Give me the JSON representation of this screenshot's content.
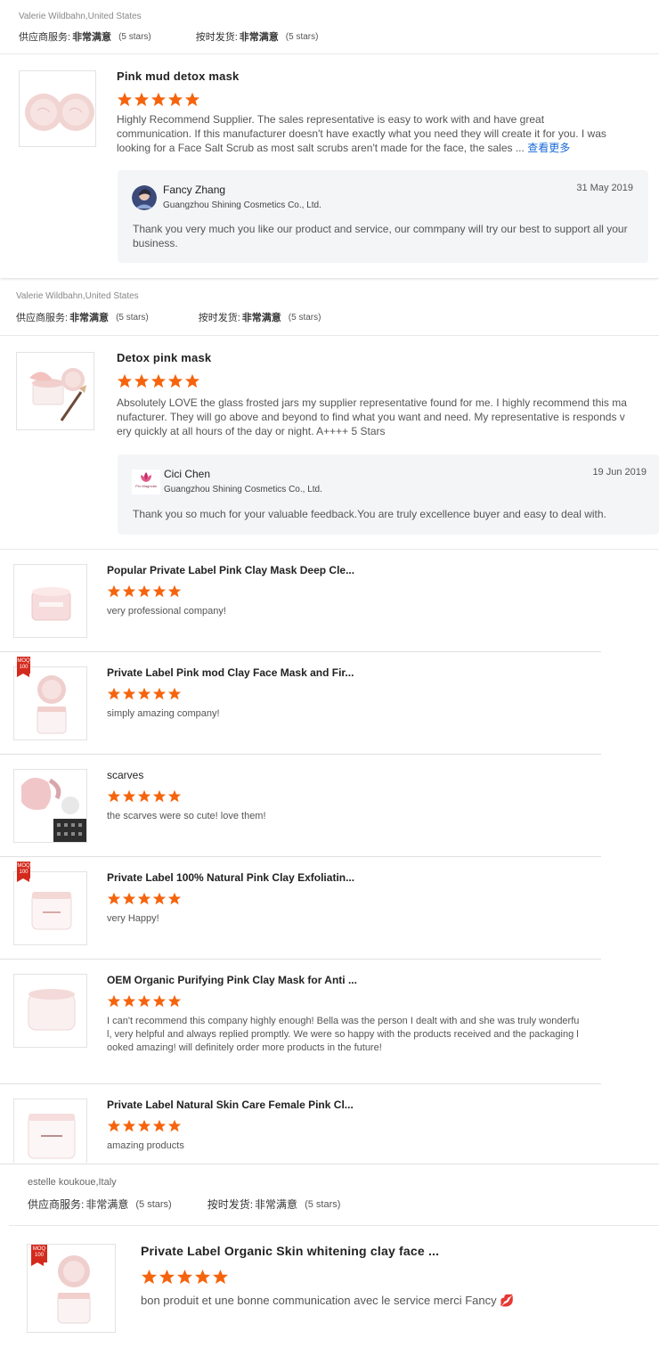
{
  "reviews": [
    {
      "reviewer": "Valerie Wildbahn,United States",
      "supplier_label": "供应商服务:",
      "supplier_value": "非常满意",
      "supplier_count": "(5 stars)",
      "shipping_label": "按时发货:",
      "shipping_value": "非常满意",
      "shipping_count": "(5 stars)",
      "product": "Pink mud detox mask",
      "text": "Highly Recommend Supplier. The sales representative is easy to work with and have great communication. If this manufacturer doesn't have exactly what you need they will create it for you. I was looking for a Face Salt Scrub as most salt scrubs aren't made for the face, the sales ...",
      "more": "查看更多",
      "reply": {
        "name": "Fancy Zhang",
        "company": "Guangzhou Shining Cosmetics Co., Ltd.",
        "date": "31 May 2019",
        "message": "Thank you very much you like our product and service, our commpany will try our best to support all your business."
      }
    },
    {
      "reviewer": "Valerie Wildbahn,United States",
      "supplier_label": "供应商服务:",
      "supplier_value": "非常满意",
      "supplier_count": "(5 stars)",
      "shipping_label": "按时发货:",
      "shipping_value": "非常满意",
      "shipping_count": "(5 stars)",
      "product": "Detox pink mask",
      "text": "Absolutely LOVE the glass frosted jars my supplier representative found for me. I highly recommend this manufacturer. They will go above and beyond to find what you want and need. My representative is responds very quickly at all hours of the day or night. A++++ 5 Stars",
      "reply": {
        "name": "Cici Chen",
        "avatar_text": "Pro Magnolia",
        "company": "Guangzhou Shining Cosmetics Co., Ltd.",
        "date": "19 Jun 2019",
        "message": "Thank you so much for your valuable feedback.You are truly excellence buyer and easy to deal with."
      }
    },
    {
      "reviewer": "estelle koukoue,Italy",
      "supplier_label": "供应商服务:",
      "supplier_value": "非常满意",
      "supplier_count": "(5 stars)",
      "shipping_label": "按时发货:",
      "shipping_value": "非常满意",
      "shipping_count": "(5 stars)",
      "product": "Private Label Organic Skin whitening clay face ...",
      "text": "bon produit et une bonne communication avec le service merci Fancy 💋",
      "moq": "MOQ 100"
    }
  ],
  "compact": [
    {
      "title": "Popular Private Label Pink Clay Mask Deep Cle...",
      "text": "very professional company!"
    },
    {
      "title": "Private Label Pink mod Clay Face Mask and Fir...",
      "text": "simply amazing company!",
      "moq": "MOQ 100"
    },
    {
      "title": "scarves",
      "text": "the scarves were so cute! love them!"
    },
    {
      "title": "Private Label 100% Natural Pink Clay Exfoliatin...",
      "text": "very Happy!",
      "moq": "MOQ 100"
    },
    {
      "title": "OEM Organic Purifying Pink Clay Mask for Anti ...",
      "text": "I can't recommend this company highly enough! Bella was the person I dealt with and she was truly wonderful, very helpful and always replied promptly. We were so happy with the products received and the packaging looked amazing! will definitely order more products in the future!"
    },
    {
      "title": "Private Label Natural Skin Care Female Pink Cl...",
      "text": "amazing products"
    }
  ],
  "rating": 5,
  "star_color": "#f5640c",
  "link_color": "#1a6ad8",
  "moq_color": "#d42a1d"
}
